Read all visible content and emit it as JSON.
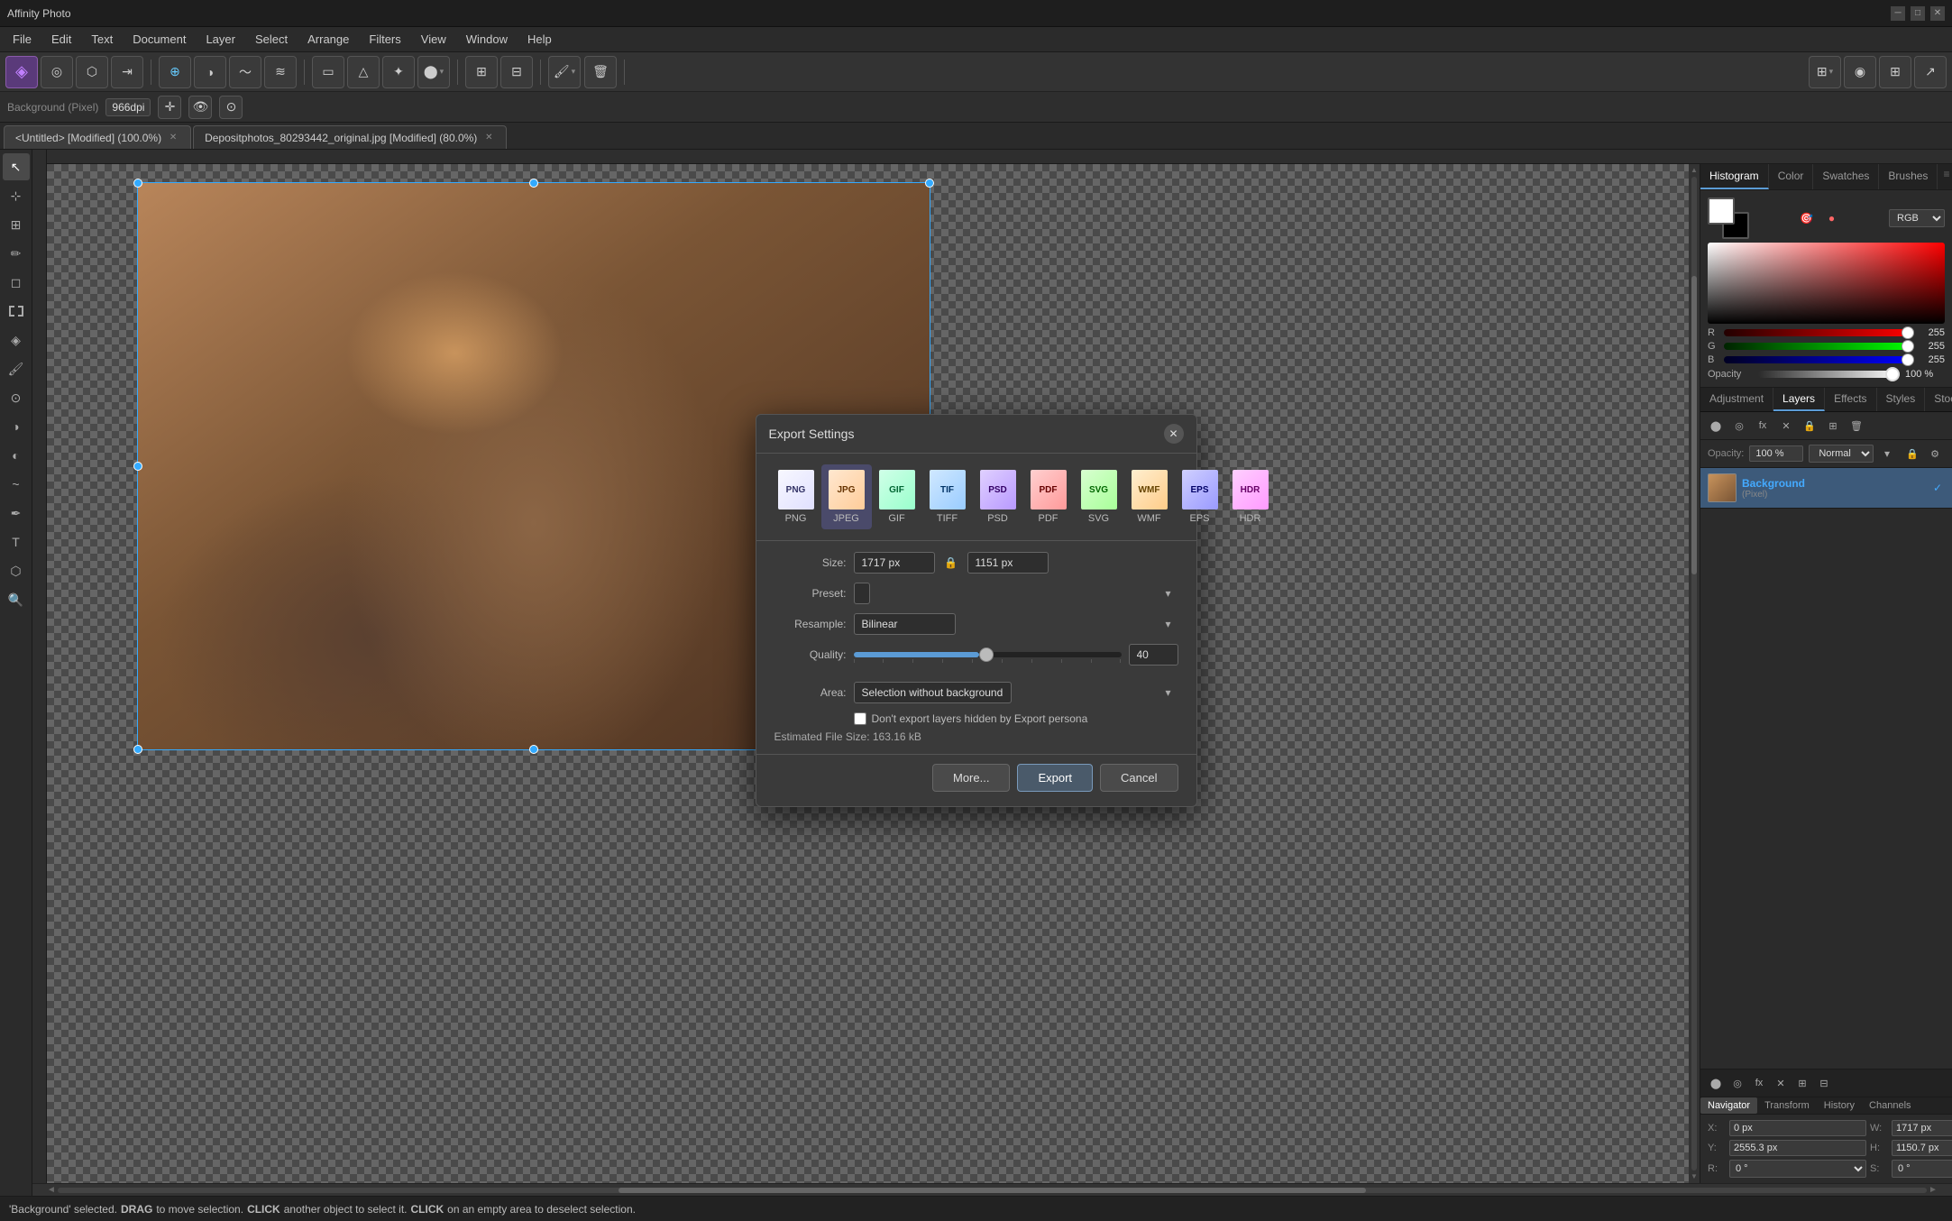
{
  "app": {
    "title": "Affinity Photo",
    "window_controls": [
      "minimize",
      "maximize",
      "close"
    ]
  },
  "menubar": {
    "items": [
      "File",
      "Edit",
      "Text",
      "Document",
      "Layer",
      "Select",
      "Arrange",
      "Filters",
      "View",
      "Window",
      "Help"
    ]
  },
  "context_toolbar": {
    "mode_label": "Background (Pixel)",
    "dpi": "966dpi"
  },
  "tabs": [
    {
      "label": "<Untitled> [Modified] (100.0%)",
      "active": true
    },
    {
      "label": "Depositphotos_80293442_original.jpg [Modified] (80.0%)",
      "active": false
    }
  ],
  "right_panel": {
    "top_tabs": [
      "Histogram",
      "Color",
      "Swatches",
      "Brushes"
    ],
    "active_top_tab": "Histogram",
    "rgb_label": "RGB",
    "channels": [
      {
        "label": "R",
        "value": "255",
        "color_class": "r"
      },
      {
        "label": "G",
        "value": "255",
        "color_class": "g"
      },
      {
        "label": "B",
        "value": "255",
        "color_class": "b"
      }
    ],
    "opacity_label": "Opacity",
    "opacity_value": "100 %",
    "adj_tabs": [
      "Adjustment",
      "Layers",
      "Effects",
      "Styles",
      "Stock"
    ],
    "active_adj_tab": "Layers",
    "layer_opacity": "100 %",
    "layer_blend": "Normal",
    "layer": {
      "name": "Background",
      "type": "(Pixel)",
      "checked": true
    },
    "bottom_tabs": [
      "Navigator",
      "Transform",
      "History",
      "Channels"
    ],
    "active_bottom_tab": "Navigator",
    "metrics": {
      "x_label": "X:",
      "x_value": "0 px",
      "y_label": "Y:",
      "y_value": "2555.3 px",
      "w_label": "W:",
      "w_value": "1717 px",
      "h_label": "H:",
      "h_value": "1150.7 px",
      "r_label": "R:",
      "r_value": "0 °",
      "s_label": "S:",
      "s_value": "0 °"
    }
  },
  "export_dialog": {
    "title": "Export Settings",
    "formats": [
      {
        "id": "png",
        "label": "PNG",
        "class": "png",
        "icon_text": "PNG",
        "selected": false
      },
      {
        "id": "jpeg",
        "label": "JPEG",
        "class": "jpg",
        "icon_text": "JPG",
        "selected": true
      },
      {
        "id": "gif",
        "label": "GIF",
        "class": "gif",
        "icon_text": "GIF",
        "selected": false
      },
      {
        "id": "tiff",
        "label": "TIFF",
        "class": "tiff",
        "icon_text": "TIF",
        "selected": false
      },
      {
        "id": "psd",
        "label": "PSD",
        "class": "psd",
        "icon_text": "PSD",
        "selected": false
      },
      {
        "id": "pdf",
        "label": "PDF",
        "class": "pdf",
        "icon_text": "PDF",
        "selected": false
      },
      {
        "id": "svg",
        "label": "SVG",
        "class": "svg",
        "icon_text": "SVG",
        "selected": false
      },
      {
        "id": "wmf",
        "label": "WMF",
        "class": "wmf",
        "icon_text": "WMF",
        "selected": false
      },
      {
        "id": "eps",
        "label": "EPS",
        "class": "eps",
        "icon_text": "EPS",
        "selected": false
      },
      {
        "id": "hdr",
        "label": "HDR",
        "class": "hdr",
        "icon_text": "HDR",
        "selected": false
      }
    ],
    "size_label": "Size:",
    "width_value": "1717 px",
    "height_value": "1151 px",
    "preset_label": "Preset:",
    "preset_value": "",
    "resample_label": "Resample:",
    "resample_value": "Bilinear",
    "quality_label": "Quality:",
    "quality_value": "40",
    "area_label": "Area:",
    "area_value": "Selection without background",
    "dont_export_label": "Don't export layers hidden by Export persona",
    "file_size_label": "Estimated File Size: 163.16 kB",
    "buttons": {
      "more": "More...",
      "export": "Export",
      "cancel": "Cancel"
    }
  },
  "statusbar": {
    "prefix": "'Background' selected. ",
    "drag_text": "DRAG",
    "drag_desc": " to move selection. ",
    "click_text": "CLICK",
    "click_desc": " another object to select it. ",
    "click2_text": "CLICK",
    "click2_desc": " on an empty area to deselect selection."
  }
}
